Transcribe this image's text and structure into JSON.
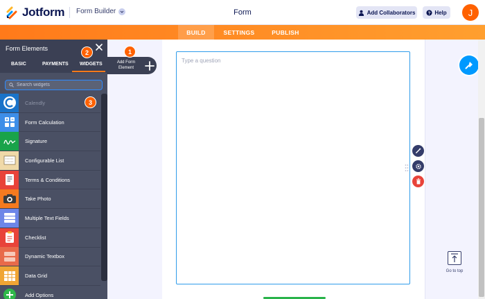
{
  "header": {
    "logo_text": "Jotform",
    "builder_label": "Form Builder",
    "form_title": "Form",
    "collab_label": "Add Collaborators",
    "help_label": "Help",
    "avatar_initial": "J"
  },
  "tabs": [
    {
      "label": "BUILD",
      "active": true
    },
    {
      "label": "SETTINGS",
      "active": false
    },
    {
      "label": "PUBLISH",
      "active": false
    }
  ],
  "left_panel": {
    "title": "Form Elements",
    "tabs": [
      {
        "label": "BASIC"
      },
      {
        "label": "PAYMENTS"
      },
      {
        "label": "WIDGETS",
        "active": true
      }
    ],
    "search_placeholder": "Search widgets",
    "items": [
      {
        "label": "Calendly",
        "icon": "calendly-icon",
        "color": "#1a73c9"
      },
      {
        "label": "Form Calculation",
        "icon": "calculator-icon",
        "color": "#3d8ee8"
      },
      {
        "label": "Signature",
        "icon": "signature-icon",
        "color": "#19a34a"
      },
      {
        "label": "Configurable List",
        "icon": "list-icon",
        "color": "#f0d9a8"
      },
      {
        "label": "Terms & Conditions",
        "icon": "document-icon",
        "color": "#e8433a"
      },
      {
        "label": "Take Photo",
        "icon": "camera-icon",
        "color": "#f47a1f"
      },
      {
        "label": "Multiple Text Fields",
        "icon": "text-fields-icon",
        "color": "#6d86e8"
      },
      {
        "label": "Checklist",
        "icon": "checklist-icon",
        "color": "#e8433a"
      },
      {
        "label": "Dynamic Textbox",
        "icon": "textbox-icon",
        "color": "#e86a4a"
      },
      {
        "label": "Data Grid",
        "icon": "grid-icon",
        "color": "#f0a534"
      },
      {
        "label": "Add Options",
        "icon": "plus-circle-icon",
        "color": "#2fb84a"
      }
    ]
  },
  "badges": [
    "1",
    "2",
    "3"
  ],
  "add_element_label": "Add Form Element",
  "question_placeholder": "Type a question",
  "go_to_top_label": "Go to top",
  "colors": {
    "accent_orange": "#ff6100",
    "accent_blue": "#0099ff",
    "panel_dark": "#4a5064"
  }
}
